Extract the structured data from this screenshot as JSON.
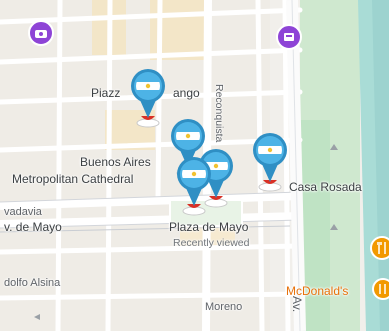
{
  "map": {
    "labels": {
      "plaza_lavalle": "Piazz",
      "plaza_lavalle_2": "ango",
      "buenos_aires": "Buenos Aires",
      "metropolitan_cathedral": "Metropolitan Cathedral",
      "rivadavia": "vadavia",
      "av_de_mayo": "v. de Mayo",
      "plaza_de_mayo": "Plaza de Mayo",
      "recently_viewed": "Recently viewed",
      "casa_rosada": "Casa Rosada",
      "hipolito_alsina": "dolfo Alsina",
      "moreno": "Moreno",
      "mcdonalds": "McDonald's",
      "reconquista": "Reconquista",
      "av_partial": "Av."
    },
    "pins": [
      {
        "name": "plaza-lavalle-pin",
        "icon": "argentina-flag-pin"
      },
      {
        "name": "buenos-aires-pin",
        "icon": "argentina-flag-pin"
      },
      {
        "name": "metropolitan-cathedral-pin",
        "icon": "argentina-flag-pin"
      },
      {
        "name": "plaza-de-mayo-pin",
        "icon": "argentina-flag-pin"
      },
      {
        "name": "casa-rosada-pin",
        "icon": "argentina-flag-pin"
      }
    ],
    "colors": {
      "pin_blue": "#4db3e6",
      "pin_dark": "#2f8fc4",
      "flag_white": "#ffffff",
      "sun": "#f2c230",
      "pin_base_red": "#d93025",
      "park_green": "#cfe8cf",
      "water_teal": "#9ed4d6",
      "poi_purple": "#8e44d6",
      "poi_orange": "#f29900"
    }
  }
}
